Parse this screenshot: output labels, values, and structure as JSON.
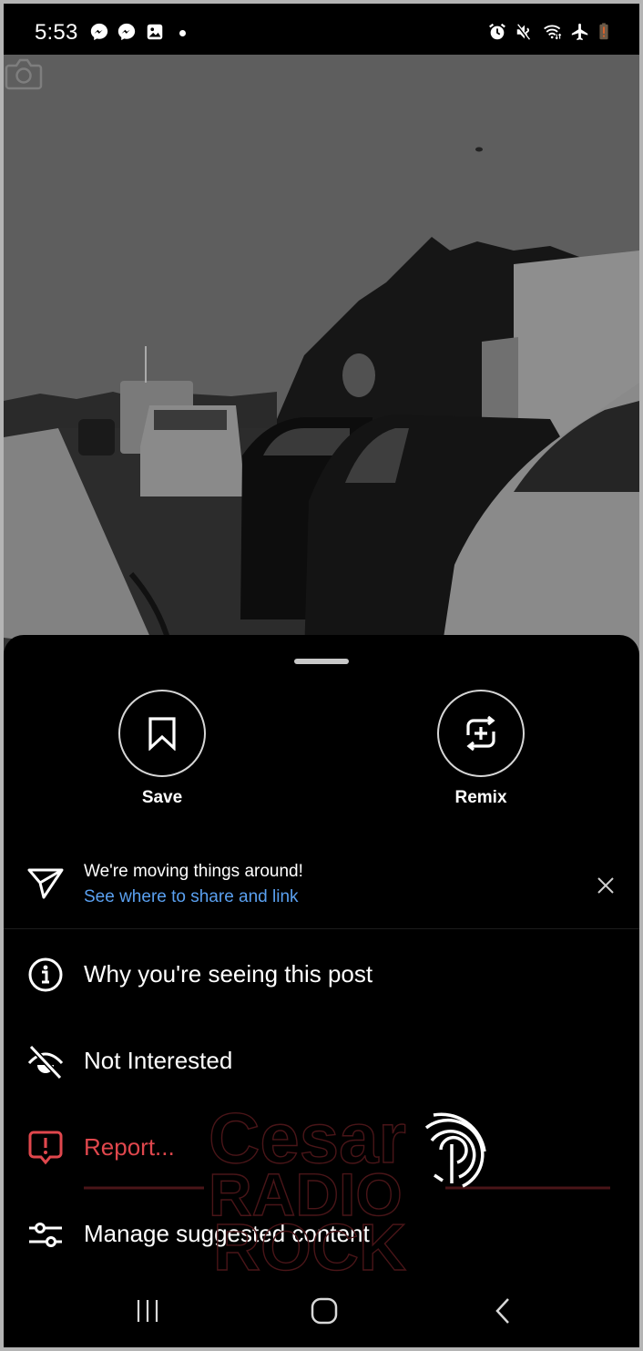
{
  "status_bar": {
    "time": "5:53",
    "left_icons": [
      "messenger-icon",
      "messenger-icon",
      "gallery-icon",
      "dot-icon"
    ],
    "right_icons": [
      "alarm-icon",
      "mute-icon",
      "wifi-icon",
      "airplane-mode-icon",
      "battery-low-icon"
    ]
  },
  "post": {
    "camera_icon": "camera-icon",
    "image_description": "Grayscale video frame of traffic jam on a highway"
  },
  "sheet": {
    "actions": [
      {
        "label": "Save",
        "icon": "bookmark-icon"
      },
      {
        "label": "Remix",
        "icon": "remix-icon"
      }
    ],
    "notice": {
      "title": "We're moving things around!",
      "link": "See where to share and link",
      "icon": "send-icon",
      "close_icon": "close-icon"
    },
    "menu": [
      {
        "label": "Why you're seeing this post",
        "icon": "info-icon"
      },
      {
        "label": "Not Interested",
        "icon": "eye-off-icon"
      },
      {
        "label": "Report...",
        "icon": "report-icon",
        "danger": true
      },
      {
        "label": "Manage suggested content",
        "icon": "sliders-icon"
      }
    ]
  },
  "watermark": {
    "line1": "Cesar",
    "line2": "RADIO",
    "line3": "ROCK"
  },
  "nav_bar": {
    "buttons": [
      "recents-icon",
      "home-icon",
      "back-icon"
    ]
  },
  "colors": {
    "link": "#5aa0f0",
    "danger": "#e0474d",
    "sheet_bg": "#000000"
  }
}
